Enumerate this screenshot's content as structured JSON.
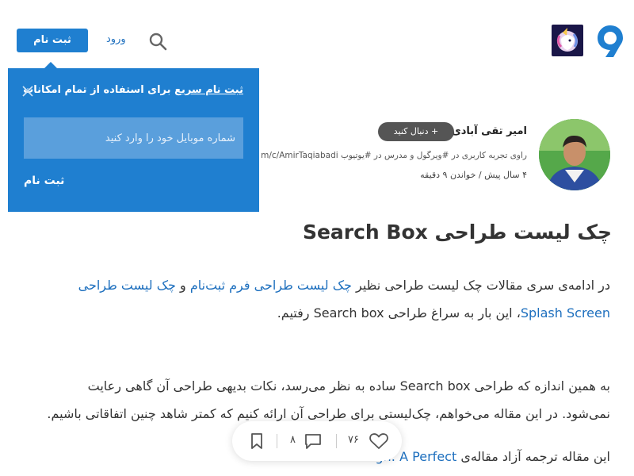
{
  "header": {
    "login_label": "ورود",
    "signup_label": "ثبت نام"
  },
  "popup": {
    "title_link": "ثبت نام سریع",
    "title_rest": " برای استفاده از تمام امکانات",
    "phone_placeholder": "شماره موبایل خود را وارد کنید",
    "submit_label": "ثبت نام"
  },
  "author": {
    "name": "امیر تقی آبادی",
    "follow_label": "+ دنبال کنید",
    "bio": "راوی تجربه کاربری در #ویرگول و مدرس در #یوتیوب youtube.com/c/AmirTaqiabadi",
    "meta": "۴ سال پیش / خواندن ۹ دقیقه"
  },
  "article": {
    "title": "چک لیست طراحی Search Box",
    "p1": {
      "t1": "در ادامه‌ی سری مقالات چک لیست طراحی نظیر ",
      "link1": "چک لیست طراحی فرم ثبت‌نام",
      "t2": " و ",
      "link2": "چک لیست طراحی Splash Screen",
      "t3": "، این بار به سراغ طراحی Search box رفتیم."
    },
    "p2": "به همین اندازه که طراحی Search box ساده به نظر می‌رسد، نکات بدیهی طراحی آن گاهی رعایت نمی‌شود. در این مقاله می‌خواهم، چک‌لیستی برای طراحی آن ارائه کنیم که کمتر شاهد چنین اتفاقاتی باشیم.",
    "p3": {
      "t1": "این مقاله ترجمه آزاد مقاله‌ی ",
      "link": "Search Box Design: A Perfect"
    }
  },
  "actions": {
    "likes": "۷۶",
    "comments": "۸"
  },
  "colors": {
    "brand_blue": "#1f7fd0",
    "link_blue": "#1d6fbe",
    "input_blue": "#5a9fdc"
  },
  "icons": [
    "virgool-logo-icon",
    "publication-icon",
    "search-icon",
    "close-icon",
    "heart-icon",
    "comment-icon",
    "bookmark-icon"
  ]
}
